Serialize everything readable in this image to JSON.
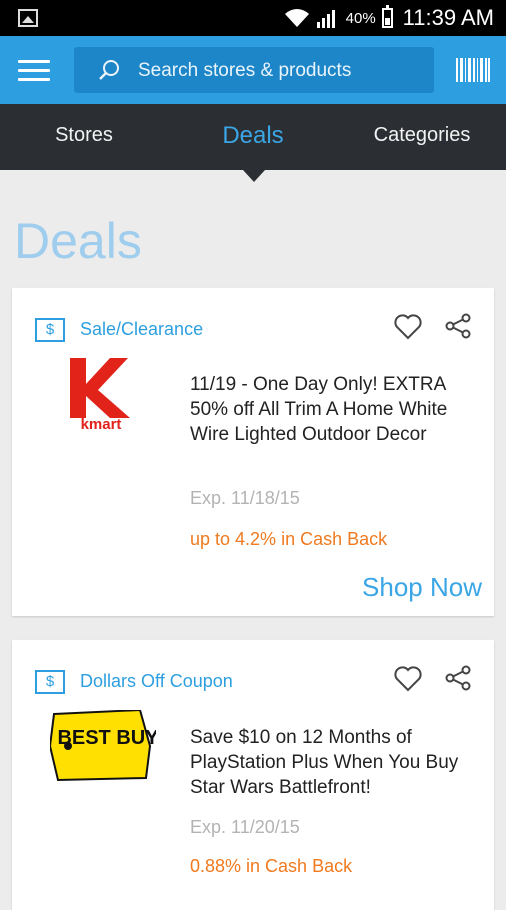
{
  "status": {
    "battery": "40%",
    "time": "11:39 AM"
  },
  "appbar": {
    "search_placeholder": "Search stores & products"
  },
  "tabs": [
    {
      "label": "Stores"
    },
    {
      "label": "Deals"
    },
    {
      "label": "Categories"
    }
  ],
  "page_title": "Deals",
  "deals": [
    {
      "type": "Sale/Clearance",
      "store": "kmart",
      "title": "11/19 - One Day Only! EXTRA 50% off All Trim A Home White Wire Lighted Outdoor Decor",
      "expiry": "Exp. 11/18/15",
      "cashback": "up to 4.2% in Cash Back",
      "cta": "Shop Now"
    },
    {
      "type": "Dollars Off Coupon",
      "store": "BEST BUY",
      "title": "Save $10 on 12 Months of PlayStation Plus When You Buy Star Wars Battlefront!",
      "expiry": "Exp. 11/20/15",
      "cashback": "0.88% in Cash Back"
    }
  ],
  "colors": {
    "accent": "#2d9fe0",
    "tabbar": "#2b2f33",
    "cashback": "#f07a1f",
    "kmart_red": "#e2231a",
    "bestbuy_yellow": "#ffe000"
  }
}
